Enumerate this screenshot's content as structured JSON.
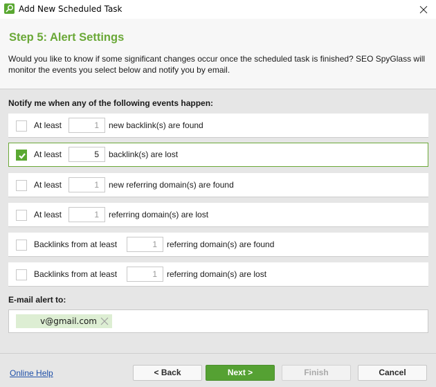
{
  "window": {
    "title": "Add New Scheduled Task",
    "app_icon": "magnifier-icon",
    "close_icon": "close-icon"
  },
  "header": {
    "step_title": "Step 5: Alert Settings",
    "description": "Would you like to know if some significant changes occur once the scheduled task is finished? SEO SpyGlass will monitor the events you select below and notify you by email."
  },
  "events": {
    "label": "Notify me when any of the following events happen:",
    "rows": [
      {
        "prefix": "At least",
        "value": "1",
        "suffix": "new backlink(s) are found",
        "checked": false
      },
      {
        "prefix": "At least",
        "value": "5",
        "suffix": "backlink(s) are lost",
        "checked": true
      },
      {
        "prefix": "At least",
        "value": "1",
        "suffix": "new referring domain(s) are found",
        "checked": false
      },
      {
        "prefix": "At least",
        "value": "1",
        "suffix": "referring domain(s) are lost",
        "checked": false
      },
      {
        "prefix": "Backlinks from at least",
        "value": "1",
        "suffix": "referring domain(s) are found",
        "checked": false
      },
      {
        "prefix": "Backlinks from at least",
        "value": "1",
        "suffix": "referring domain(s) are lost",
        "checked": false
      }
    ]
  },
  "email": {
    "label": "E-mail alert to:",
    "recipients": [
      "v@gmail.com"
    ]
  },
  "footer": {
    "help_link": "Online Help",
    "back": "< Back",
    "next": "Next >",
    "finish": "Finish",
    "cancel": "Cancel"
  },
  "colors": {
    "accent": "#5aa832",
    "title_green": "#6aa837",
    "tag_bg": "#ddeed3",
    "link": "#1e4fa8"
  }
}
